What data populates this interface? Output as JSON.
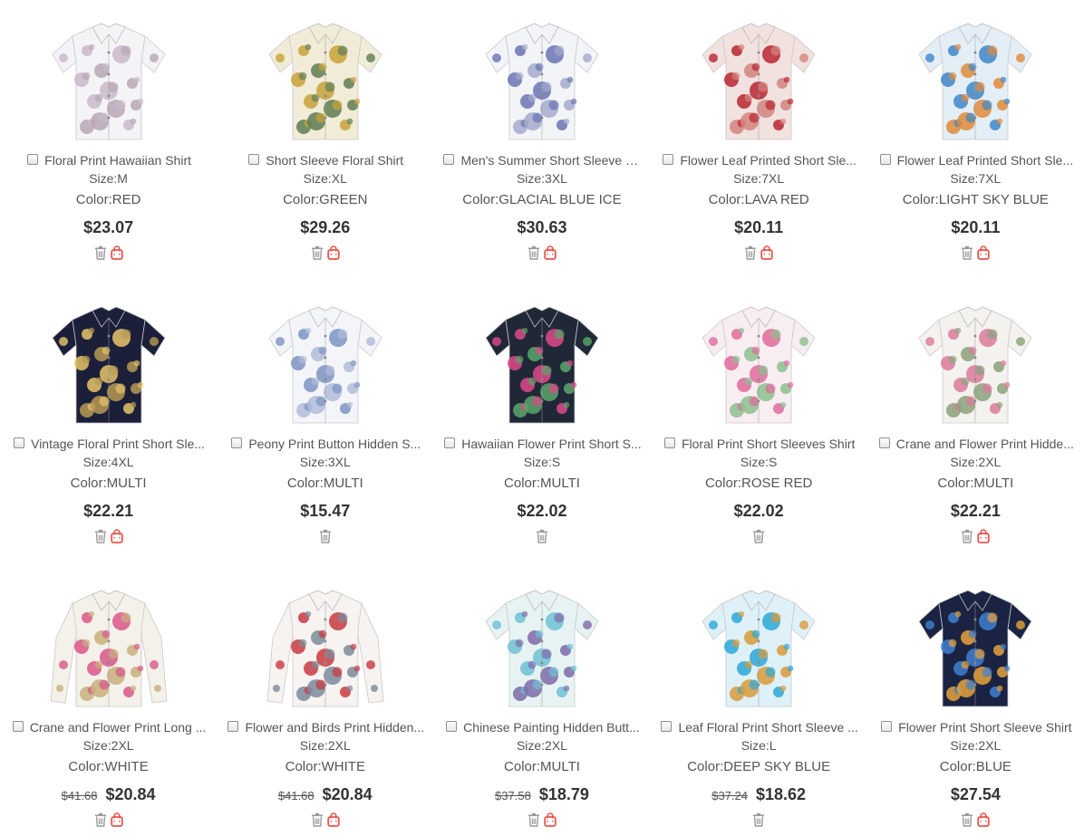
{
  "products": [
    {
      "title": "Floral Print Hawaiian Shirt",
      "size": "Size:M",
      "color": "Color:RED",
      "old_price": "",
      "price": "$23.07",
      "has_bag": true,
      "shirt": {
        "base": "#f4f4f6",
        "p1": "#c9b9c9",
        "p2": "#b7a6b6",
        "long": false
      }
    },
    {
      "title": "Short Sleeve Floral Shirt",
      "size": "Size:XL",
      "color": "Color:GREEN",
      "old_price": "",
      "price": "$29.26",
      "has_bag": true,
      "shirt": {
        "base": "#f1ecd8",
        "p1": "#c8a238",
        "p2": "#5f7d52",
        "long": false
      }
    },
    {
      "title": "Men's Summer Short Sleeve S...",
      "size": "Size:3XL",
      "color": "Color:GLACIAL BLUE ICE",
      "old_price": "",
      "price": "$30.63",
      "has_bag": true,
      "shirt": {
        "base": "#f3f4f8",
        "p1": "#6a73b2",
        "p2": "#a3aacc",
        "long": false
      }
    },
    {
      "title": "Flower Leaf Printed Short Sle...",
      "size": "Size:7XL",
      "color": "Color:LAVA RED",
      "old_price": "",
      "price": "$20.11",
      "has_bag": true,
      "shirt": {
        "base": "#f1e2e0",
        "p1": "#b9262f",
        "p2": "#d3847f",
        "long": false
      }
    },
    {
      "title": "Flower Leaf Printed Short Sle...",
      "size": "Size:7XL",
      "color": "Color:LIGHT SKY BLUE",
      "old_price": "",
      "price": "$20.11",
      "has_bag": true,
      "shirt": {
        "base": "#e4eef7",
        "p1": "#3f86c8",
        "p2": "#e08a3a",
        "long": false
      }
    },
    {
      "title": "Vintage Floral Print Short Sle...",
      "size": "Size:4XL",
      "color": "Color:MULTI",
      "old_price": "",
      "price": "$22.21",
      "has_bag": true,
      "shirt": {
        "base": "#1c1f3a",
        "p1": "#e7c56a",
        "p2": "#b79a55",
        "long": false
      }
    },
    {
      "title": "Peony Print Button Hidden S...",
      "size": "Size:3XL",
      "color": "Color:MULTI",
      "old_price": "",
      "price": "$15.47",
      "has_bag": false,
      "shirt": {
        "base": "#f4f5f9",
        "p1": "#7b93c3",
        "p2": "#b0bcd8",
        "long": false
      }
    },
    {
      "title": "Hawaiian Flower Print Short S...",
      "size": "Size:S",
      "color": "Color:MULTI",
      "old_price": "",
      "price": "$22.02",
      "has_bag": false,
      "shirt": {
        "base": "#202838",
        "p1": "#e0488a",
        "p2": "#5aa66a",
        "long": false
      }
    },
    {
      "title": "Floral Print Short Sleeves Shirt",
      "size": "Size:S",
      "color": "Color:ROSE RED",
      "old_price": "",
      "price": "$22.02",
      "has_bag": false,
      "shirt": {
        "base": "#f8eef2",
        "p1": "#e06a9c",
        "p2": "#8cbf8e",
        "long": false
      }
    },
    {
      "title": "Crane and Flower Print Hidde...",
      "size": "Size:2XL",
      "color": "Color:MULTI",
      "old_price": "",
      "price": "$22.21",
      "has_bag": true,
      "shirt": {
        "base": "#f4f2ee",
        "p1": "#d97a9a",
        "p2": "#8aa27a",
        "long": false
      }
    },
    {
      "title": "Crane and Flower Print Long ...",
      "size": "Size:2XL",
      "color": "Color:WHITE",
      "old_price": "$41.68",
      "price": "$20.84",
      "has_bag": true,
      "shirt": {
        "base": "#f4f1ea",
        "p1": "#d9568a",
        "p2": "#c7b07a",
        "long": true
      }
    },
    {
      "title": "Flower and Birds Print Hidden...",
      "size": "Size:2XL",
      "color": "Color:WHITE",
      "old_price": "$41.68",
      "price": "$20.84",
      "has_bag": true,
      "shirt": {
        "base": "#f6f3f1",
        "p1": "#c9383f",
        "p2": "#7a8a9a",
        "long": true
      }
    },
    {
      "title": "Chinese Painting Hidden Butt...",
      "size": "Size:2XL",
      "color": "Color:MULTI",
      "old_price": "$37.58",
      "price": "$18.79",
      "has_bag": true,
      "shirt": {
        "base": "#e7f3f3",
        "p1": "#6fbfd3",
        "p2": "#7d6aa8",
        "long": false
      }
    },
    {
      "title": "Leaf Floral Print Short Sleeve ...",
      "size": "Size:L",
      "color": "Color:DEEP SKY BLUE",
      "old_price": "$37.24",
      "price": "$18.62",
      "has_bag": false,
      "shirt": {
        "base": "#dff1f8",
        "p1": "#2aa8d8",
        "p2": "#d89a3a",
        "long": false
      }
    },
    {
      "title": "Flower Print Short Sleeve Shirt",
      "size": "Size:2XL",
      "color": "Color:BLUE",
      "old_price": "",
      "price": "$27.54",
      "has_bag": true,
      "shirt": {
        "base": "#1b2342",
        "p1": "#3f7fd0",
        "p2": "#e8a33a",
        "long": false
      }
    }
  ],
  "colors": {
    "bag_icon": "#e8554e",
    "trash_icon": "#9a9a9a"
  }
}
